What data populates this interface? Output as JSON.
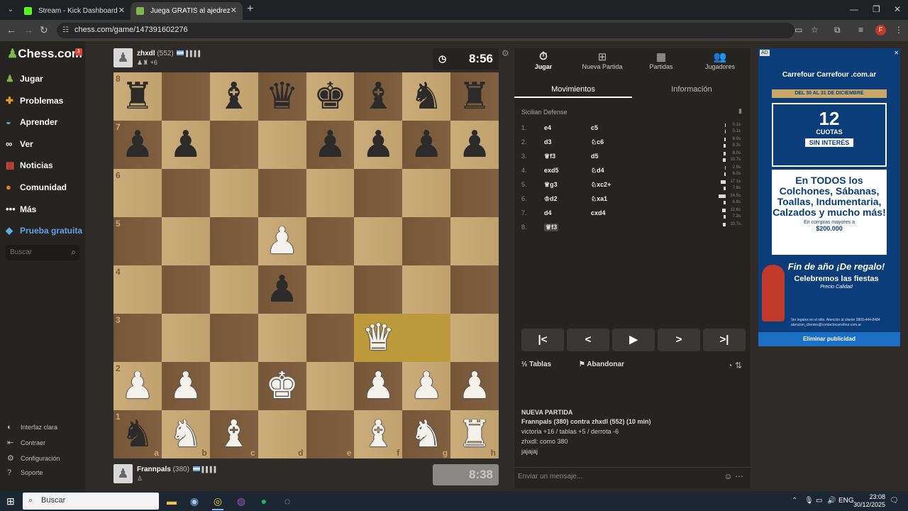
{
  "browser": {
    "tabs": [
      {
        "title": "Stream - Kick Dashboard",
        "active": false
      },
      {
        "title": "Juega GRATIS al ajedrez online",
        "active": true
      }
    ],
    "url": "chess.com/game/147391602276"
  },
  "sidebar": {
    "logo": "Chess.com",
    "logo_badge": "1",
    "items": [
      {
        "label": "Jugar",
        "icon": "pawn-icon"
      },
      {
        "label": "Problemas",
        "icon": "puzzle-icon"
      },
      {
        "label": "Aprender",
        "icon": "learn-icon"
      },
      {
        "label": "Ver",
        "icon": "binoculars-icon"
      },
      {
        "label": "Noticias",
        "icon": "news-icon"
      },
      {
        "label": "Comunidad",
        "icon": "community-icon"
      },
      {
        "label": "Más",
        "icon": "more-icon"
      },
      {
        "label": "Prueba gratuita",
        "icon": "diamond-icon"
      }
    ],
    "search_placeholder": "Buscar",
    "footer": [
      {
        "label": "Interfaz clara",
        "icon": "contrast-icon"
      },
      {
        "label": "Contraer",
        "icon": "collapse-icon"
      },
      {
        "label": "Configuración",
        "icon": "gear-icon"
      },
      {
        "label": "Soporte",
        "icon": "help-icon"
      }
    ]
  },
  "top_player": {
    "name": "zhxdl",
    "rating": "(552)",
    "bars": "▌▌▌▌",
    "extra": "♟♜ +6",
    "clock": "8:56"
  },
  "bottom_player": {
    "name": "Frannpals",
    "rating": "(380)",
    "bars": "▌▌▌▌",
    "extra": "♙",
    "clock": "8:38"
  },
  "board": {
    "position": [
      [
        "bR",
        "",
        "bB",
        "bQ",
        "bK",
        "bB",
        "bN",
        "bR"
      ],
      [
        "bP",
        "bP",
        "",
        "",
        "bP",
        "bP",
        "bP",
        "bP"
      ],
      [
        "",
        "",
        "",
        "",
        "",
        "",
        "",
        ""
      ],
      [
        "",
        "",
        "",
        "wP",
        "",
        "",
        "",
        ""
      ],
      [
        "",
        "",
        "",
        "bP",
        "",
        "",
        "",
        ""
      ],
      [
        "",
        "",
        "",
        "",
        "",
        "wQ",
        "",
        ""
      ],
      [
        "wP",
        "wP",
        "",
        "wK",
        "",
        "wP",
        "wP",
        "wP"
      ],
      [
        "bN",
        "wN",
        "wB",
        "",
        "",
        "wB",
        "wN",
        "wR"
      ]
    ],
    "highlight": [
      [
        5,
        5
      ],
      [
        5,
        6
      ]
    ],
    "ranks": [
      "8",
      "7",
      "6",
      "5",
      "4",
      "3",
      "2",
      "1"
    ],
    "files": [
      "a",
      "b",
      "c",
      "d",
      "e",
      "f",
      "g",
      "h"
    ]
  },
  "panel": {
    "tabs": [
      {
        "label": "Jugar",
        "icon": "stopwatch-icon"
      },
      {
        "label": "Nueva Partida",
        "icon": "plus-icon"
      },
      {
        "label": "Partidas",
        "icon": "board-icon"
      },
      {
        "label": "Jugadores",
        "icon": "players-icon"
      }
    ],
    "subtabs": [
      "Movimientos",
      "Información"
    ],
    "opening": "Sicilian Defense",
    "moves": [
      {
        "n": "1.",
        "w": "e4",
        "b": "c5",
        "wt": "0.1s",
        "bt": "0.1s"
      },
      {
        "n": "2.",
        "w": "d3",
        "b": "♘c6",
        "wt": "6.0s",
        "bt": "8.3s"
      },
      {
        "n": "3.",
        "w": "♕f3",
        "b": "d5",
        "wt": "8.0s",
        "bt": "10.7s"
      },
      {
        "n": "4.",
        "w": "exd5",
        "b": "♘d4",
        "wt": "2.9s",
        "bt": "6.0s"
      },
      {
        "n": "5.",
        "w": "♕g3",
        "b": "♘xc2+",
        "wt": "17.1s",
        "bt": "7.8s"
      },
      {
        "n": "6.",
        "w": "♔d2",
        "b": "♘xa1",
        "wt": "24.5s",
        "bt": "6.6s"
      },
      {
        "n": "7.",
        "w": "d4",
        "b": "cxd4",
        "wt": "12.6s",
        "bt": "7.3s"
      },
      {
        "n": "8.",
        "w": "♕f3",
        "b": "",
        "wt": "10.7s",
        "bt": ""
      }
    ],
    "actions": {
      "draw": "Tablas",
      "resign": "Abandonar"
    },
    "chat": {
      "title": "NUEVA PARTIDA",
      "line1": "Frannpals (380) contra zhxdl (552) (10 min)",
      "line2": "victoria +16 / tablas +5 / derrota -6",
      "line3": "zhxdl: como 380",
      "line4": "jajajaj"
    },
    "message_placeholder": "Enviar un mensaje..."
  },
  "ad": {
    "label": "AD",
    "brand": "Carrefour  Carrefour .com.ar",
    "date": "DEL 30 AL 31 DE DICIEMBRE",
    "big": "12",
    "cuotas": "CUOTAS",
    "badge": "SIN INTERÉS",
    "card2_big": "En TODOS los Colchones, Sábanas, Toallas, Indumentaria, Calzados y mucho más!",
    "card2_sm": "En compras mayores a",
    "card2_price": "$200.000",
    "promo1": "Fin de año ¡De regalo!",
    "promo2": "Celebremos las fiestas",
    "promo3": "Precio Calidad",
    "legal": "Ver legales en el sitio. Atención al cliente 0800-444-8484 atencion_clientes@contactocarrefour.com.ar",
    "remove": "Eliminar publicidad"
  },
  "taskbar": {
    "search": "Buscar",
    "lang": "ENG",
    "time": "23:08",
    "date": "30/12/2025"
  }
}
